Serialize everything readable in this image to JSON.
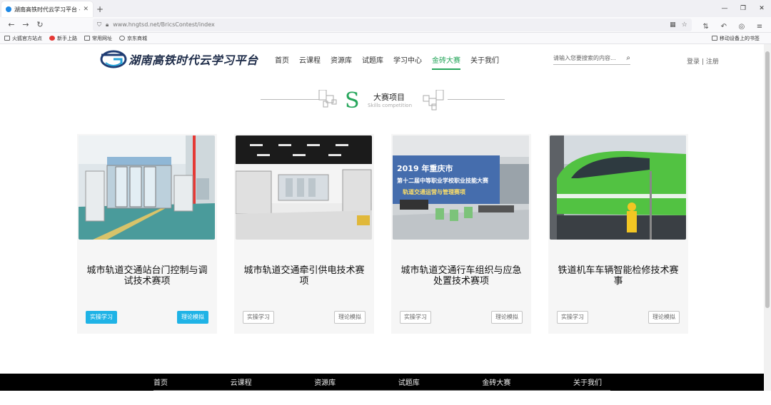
{
  "browser": {
    "tab_title": "湖南高铁时代云学习平台 - 主页",
    "url": "www.hngtsd.net/BricsContest/index",
    "bookmarks": [
      "火狐官方站点",
      "新手上路",
      "常用网址",
      "京东商城"
    ],
    "bookmarks_right": "移动设备上的书签"
  },
  "site": {
    "logo_text": "湖南高铁时代云学习平台",
    "nav": [
      "首页",
      "云课程",
      "资源库",
      "试题库",
      "学习中心",
      "金砖大赛",
      "关于我们"
    ],
    "active_nav": "金砖大赛",
    "search_placeholder": "请输入您要搜索的内容...",
    "login": "登录",
    "register": "注册",
    "auth_sep": "|"
  },
  "section": {
    "letter": "S",
    "title_zh": "大赛项目",
    "title_en": "Skills competition"
  },
  "cards": [
    {
      "title": "城市轨道交通站台门控制与调试技术赛项",
      "btn_left": "实操学习",
      "btn_right": "理论模拟",
      "highlighted": true
    },
    {
      "title": "城市轨道交通牵引供电技术赛项",
      "btn_left": "实操学习",
      "btn_right": "理论模拟",
      "highlighted": false
    },
    {
      "title": "城市轨道交通行车组织与应急处置技术赛项",
      "btn_left": "实操学习",
      "btn_right": "理论模拟",
      "highlighted": false
    },
    {
      "title": "铁道机车车辆智能检修技术赛事",
      "btn_left": "实操学习",
      "btn_right": "理论模拟",
      "highlighted": false
    }
  ],
  "photo3_banner": {
    "line1": "2019 年重庆市",
    "line2": "第十二届中等职业学校职业技能大赛",
    "line3": "轨道交通运营与管理赛项"
  },
  "footer_nav": [
    "首页",
    "云课程",
    "资源库",
    "试题库",
    "金砖大赛",
    "关于我们"
  ],
  "colors": {
    "accent": "#26a65b",
    "button_active": "#1fb3e6",
    "footer_bg": "#000000"
  }
}
